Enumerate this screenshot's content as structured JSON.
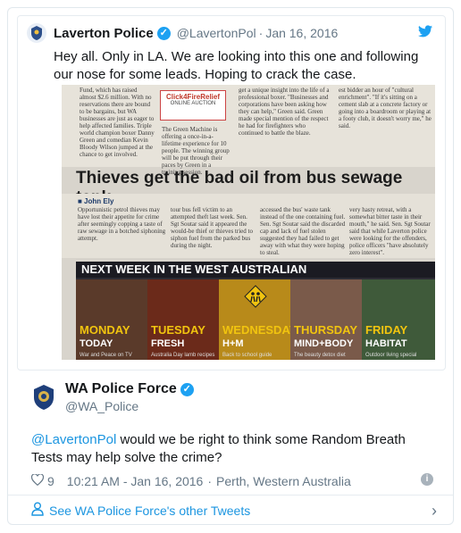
{
  "quoted_tweet": {
    "name": "Laverton Police",
    "handle": "@LavertonPol",
    "separator": "·",
    "date": "Jan 16, 2016",
    "text": "Hey all. Only in LA. We are looking into this one and following our nose for some leads. Hoping to crack the case.",
    "photo": {
      "headline": "Thieves get the bad oil from bus sewage tank",
      "byline": "■ John Ely",
      "ad_title": "Click4FireRelief",
      "ad_sub": "ONLINE AUCTION",
      "banner_title": "NEXT WEEK IN THE WEST AUSTRALIAN",
      "days": [
        {
          "name": "MONDAY",
          "topic": "TODAY",
          "caption": "War and Peace on TV"
        },
        {
          "name": "TUESDAY",
          "topic": "FRESH",
          "caption": "Australia Day lamb recipes"
        },
        {
          "name": "WEDNESDAY",
          "topic": "H+M",
          "caption": "Back to school guide"
        },
        {
          "name": "THURSDAY",
          "topic": "MIND+BODY",
          "caption": "The beauty detox diet"
        },
        {
          "name": "FRIDAY",
          "topic": "HABITAT",
          "caption": "Outdoor living special"
        }
      ]
    }
  },
  "tweet": {
    "name": "WA Police Force",
    "handle": "@WA_Police",
    "mention": "@LavertonPol",
    "text": " would we be right to think some Random Breath Tests may help solve the crime?",
    "likes": "9",
    "time": "10:21 AM - Jan 16, 2016",
    "location_sep": "·",
    "location": "Perth, Western Australia"
  },
  "footer": {
    "link_text": "See WA Police Force's other Tweets"
  },
  "colors": {
    "link": "#1b95e0",
    "muted": "#657786",
    "verified": "#1da1f2"
  }
}
